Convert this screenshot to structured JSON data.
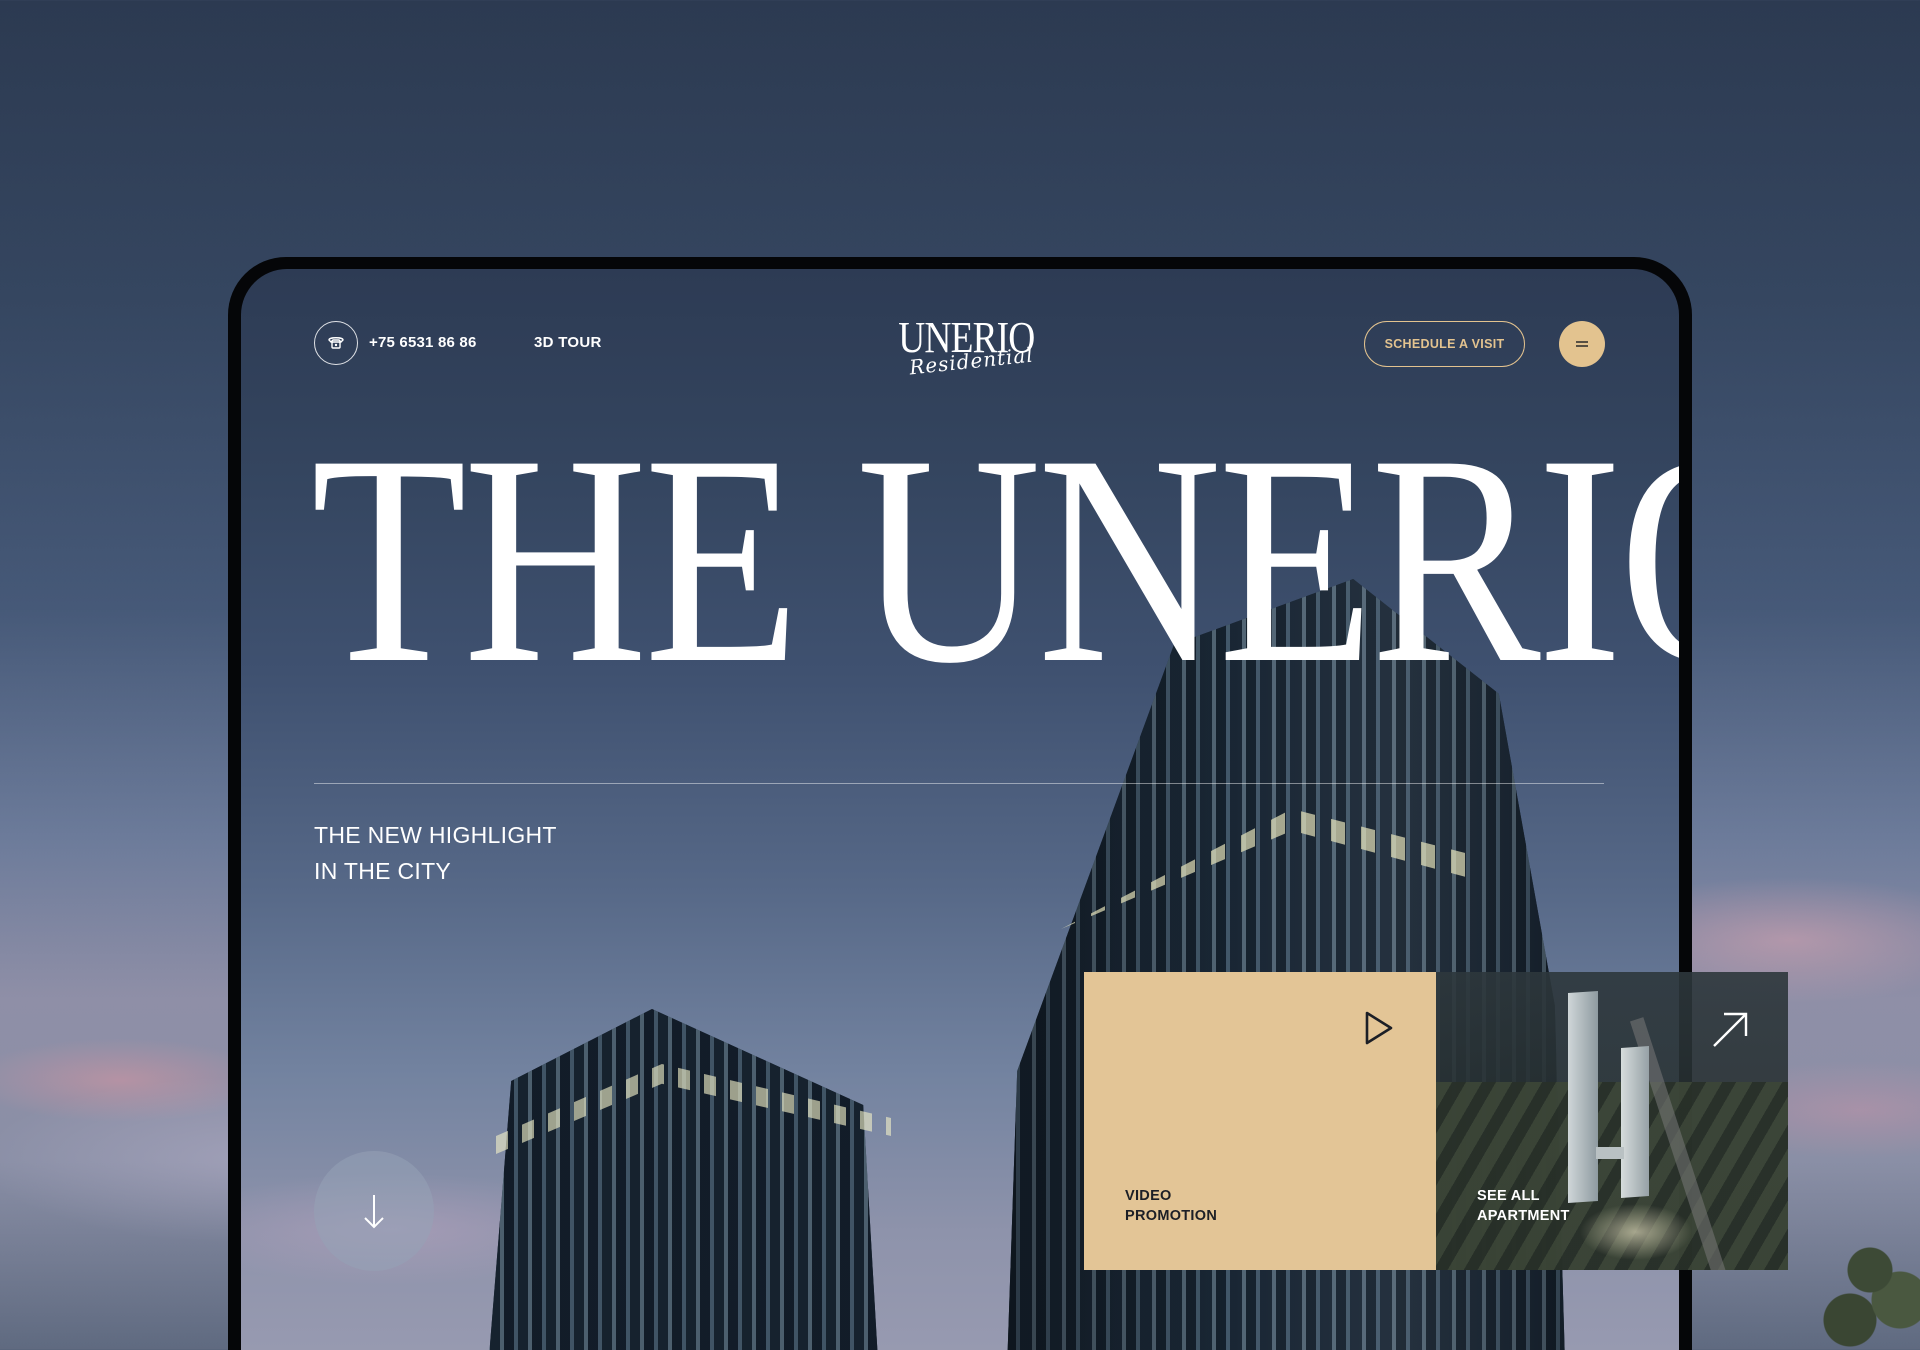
{
  "header": {
    "phone_icon": "phone-icon",
    "phone_number": "+75 6531 86 86",
    "tour_label": "3D TOUR",
    "logo_main": "UNERIO",
    "logo_script": "Residential",
    "schedule_label": "SCHEDULE A VISIT",
    "menu_icon": "hamburger-menu-icon"
  },
  "hero": {
    "title": "THE UNERIO",
    "subtitle_line1": "THE NEW HIGHLIGHT",
    "subtitle_line2": "IN THE CITY",
    "scroll_icon": "arrow-down-icon"
  },
  "cards": {
    "video": {
      "label_line1": "VIDEO",
      "label_line2": "PROMOTION",
      "icon": "play-icon"
    },
    "apartment": {
      "label_line1": "SEE ALL",
      "label_line2": "APARTMENT",
      "icon": "arrow-up-right-icon"
    }
  },
  "colors": {
    "accent": "#e3c38f",
    "card_bg": "#e3c596",
    "text": "#ffffff",
    "dark_text": "#1c1f26"
  }
}
